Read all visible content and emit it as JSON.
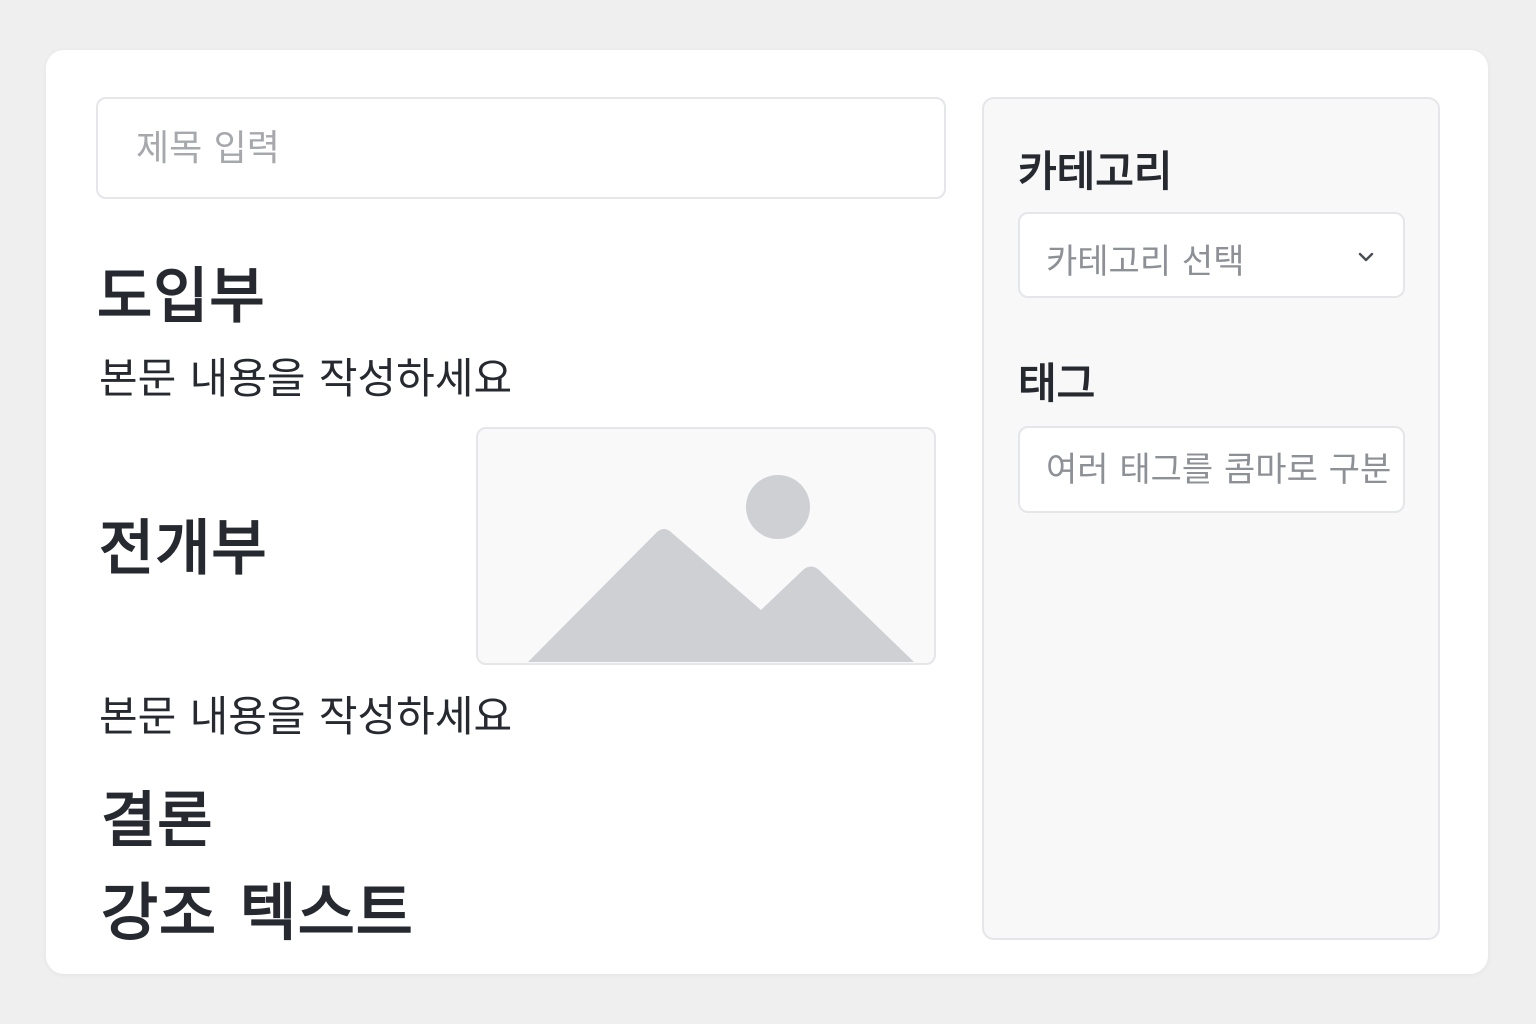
{
  "editor": {
    "title_placeholder": "제목 입력",
    "sections": {
      "intro_heading": "도입부",
      "body_1": "본문 내용을 작성하세요",
      "develop_heading": "전개부",
      "body_2": "본문 내용을 작성하세요",
      "conclusion_heading": "결론",
      "emphasis_text": "강조 텍스트"
    },
    "image": {
      "icon": "image-placeholder-icon"
    }
  },
  "sidebar": {
    "category_label": "카테고리",
    "category_select_value": "카테고리 선택",
    "tags_label": "태그",
    "tags_placeholder": "여러 태그를 콤마로 구분"
  },
  "colors": {
    "text": "#262a30",
    "placeholder": "#a6a8ad",
    "border": "#e5e6ea",
    "sidebar_bg": "#f8f8f9",
    "image_shape": "#cfd0d4"
  }
}
